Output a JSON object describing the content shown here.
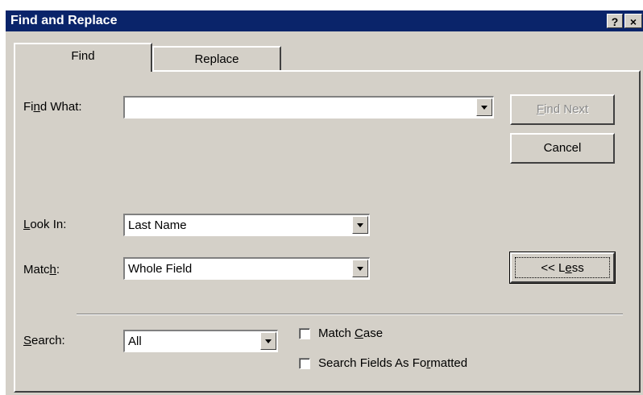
{
  "window": {
    "title": "Find and Replace",
    "help_label": "?",
    "close_label": "×"
  },
  "tabs": [
    {
      "label": "Find",
      "active": true
    },
    {
      "label": "Replace",
      "active": false
    }
  ],
  "find_what": {
    "label_pre": "Fi",
    "label_key": "n",
    "label_post": "d What:",
    "value": ""
  },
  "look_in": {
    "label_pre": "",
    "label_key": "L",
    "label_post": "ook In:",
    "value": "Last Name"
  },
  "match": {
    "label_pre": "Matc",
    "label_key": "h",
    "label_post": ":",
    "value": "Whole Field"
  },
  "search": {
    "label_pre": "",
    "label_key": "S",
    "label_post": "earch:",
    "value": "All"
  },
  "buttons": {
    "find_next": {
      "pre": "",
      "key": "F",
      "post": "ind Next",
      "enabled": false
    },
    "cancel": "Cancel",
    "less": {
      "pre": "<< L",
      "key": "e",
      "post": "ss"
    }
  },
  "options": {
    "match_case": {
      "pre": "Match ",
      "key": "C",
      "post": "ase",
      "checked": false
    },
    "search_formatted": {
      "pre": "Search Fields As Fo",
      "key": "r",
      "post": "matted",
      "checked": false
    }
  }
}
